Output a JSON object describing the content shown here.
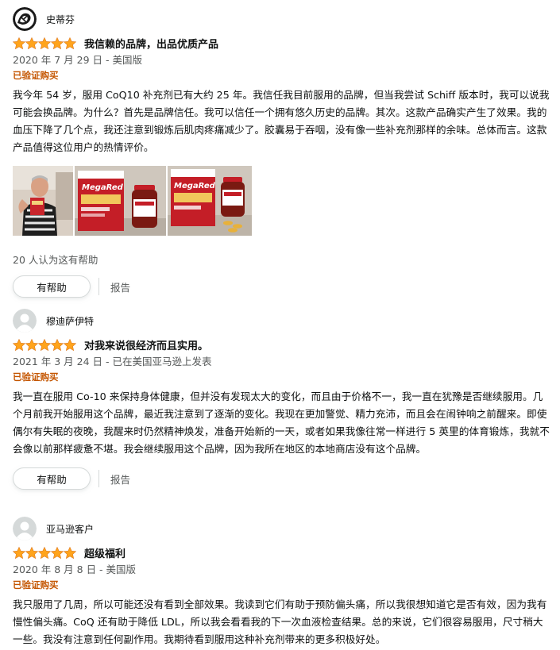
{
  "colors": {
    "star": "#ffa41c",
    "verified": "#c45500",
    "muted": "#565959",
    "text": "#0f1111"
  },
  "reviews": [
    {
      "profile_name": "史蒂芬",
      "avatar": "custom-avatar-icon",
      "rating": 5,
      "title": "我信赖的品牌，出品优质产品",
      "date": "2020 年 7 月 29 日 - 美国版",
      "verified": "已验证购买",
      "body": "我今年 54 岁，服用 CoQ10 补充剂已有大约 25 年。我信任我目前服用的品牌，但当我尝试 Schiff 版本时，我可以说我可能会换品牌。为什么？首先是品牌信任。我可以信任一个拥有悠久历史的品牌。其次。这款产品确实产生了效果。我的血压下降了几个点，我还注意到锻炼后肌肉疼痛减少了。胶囊易于吞咽，没有像一些补充剂那样的余味。总体而言。这款产品值得这位用户的热情评价。",
      "images": [
        "man-holding-product",
        "megared-box-and-bottle",
        "megared-box-bottle-capsules"
      ],
      "helpful_count": "20 人认为这有帮助",
      "helpful_button": "有帮助",
      "report": "报告"
    },
    {
      "profile_name": "穆迪萨伊特",
      "avatar": "default-avatar-icon",
      "rating": 5,
      "title": "对我来说很经济而且实用。",
      "date": "2021 年 3 月 24 日 - 已在美国亚马逊上发表",
      "verified": "已验证购买",
      "body": "我一直在服用 Co-10 来保持身体健康，但并没有发现太大的变化，而且由于价格不一，我一直在犹豫是否继续服用。几个月前我开始服用这个品牌，最近我注意到了逐渐的变化。我现在更加警觉、精力充沛，而且会在闹钟响之前醒来。即使偶尔有失眠的夜晚，我醒来时仍然精神焕发，准备开始新的一天，或者如果我像往常一样进行 5 英里的体育锻炼，我就不会像以前那样疲惫不堪。我会继续服用这个品牌，因为我所在地区的本地商店没有这个品牌。",
      "helpful_button": "有帮助",
      "report": "报告"
    },
    {
      "profile_name": "亚马逊客户",
      "avatar": "default-avatar-icon",
      "rating": 5,
      "title": "超级福利",
      "date": "2020 年 8 月 8 日 - 美国版",
      "verified": "已验证购买",
      "body": "我只服用了几周，所以可能还没有看到全部效果。我读到它们有助于预防偏头痛，所以我很想知道它是否有效，因为我有慢性偏头痛。CoQ 还有助于降低 LDL，所以我会看看我的下一次血液检查结果。总的来说，它们很容易服用，尺寸稍大一些。我没有注意到任何副作用。我期待看到服用这种补充剂带来的更多积极好处。"
    }
  ]
}
